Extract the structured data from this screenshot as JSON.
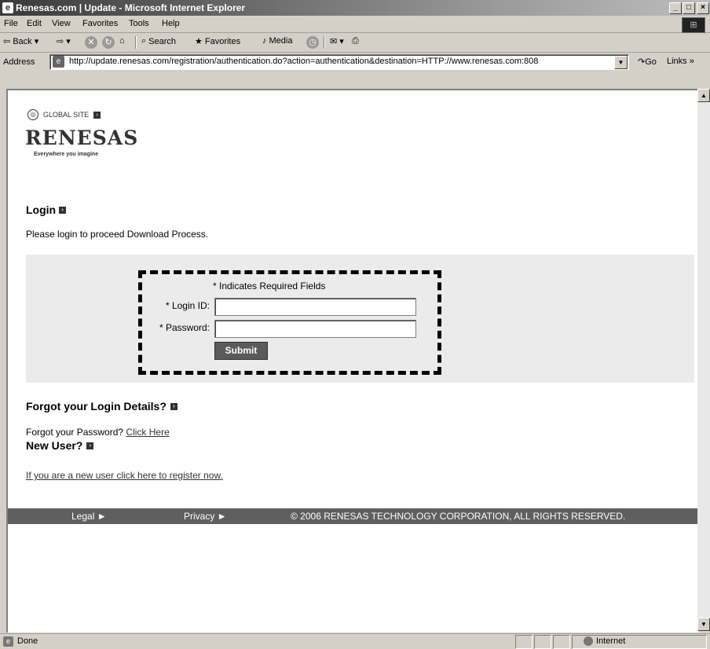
{
  "window": {
    "title": "Renesas.com | Update - Microsoft Internet Explorer",
    "minimize_glyph": "_",
    "maximize_glyph": "□",
    "close_glyph": "×"
  },
  "menu": [
    "File",
    "Edit",
    "View",
    "Favorites",
    "Tools",
    "Help"
  ],
  "toolbar": {
    "back_label": "Back",
    "search_label": "Search",
    "favorites_label": "Favorites",
    "media_label": "Media"
  },
  "address": {
    "label": "Address",
    "url": "http://update.renesas.com/registration/authentication.do?action=authentication&destination=HTTP://www.renesas.com:808",
    "go_label": "Go",
    "links_label": "Links »"
  },
  "page": {
    "global_site": "GLOBAL SITE",
    "logo_text": "RENESAS",
    "tagline": "Everywhere you imagine",
    "login_heading": "Login",
    "login_description": "Please login to proceed Download Process.",
    "required_note": "* Indicates Required Fields",
    "login_id_label": "* Login ID:",
    "password_label": "* Password:",
    "login_id_value": "",
    "password_value": "",
    "submit_label": "Submit",
    "forgot_heading": "Forgot your Login Details?",
    "forgot_text": "Forgot your Password?",
    "forgot_link": "Click Here",
    "new_user_heading": "New User?",
    "register_link": "If you are a new user click here to register now."
  },
  "footer": {
    "legal": "Legal ►",
    "privacy": "Privacy ►",
    "copyright": "© 2006 RENESAS TECHNOLOGY CORPORATION, ALL RIGHTS RESERVED."
  },
  "status": {
    "text": "Done",
    "zone": "Internet"
  }
}
